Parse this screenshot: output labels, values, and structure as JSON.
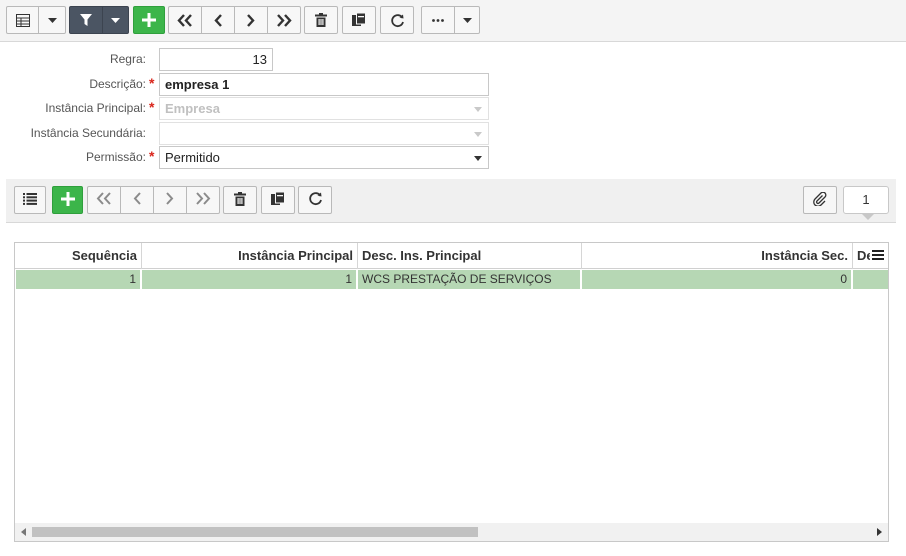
{
  "toolbar": {
    "icons": [
      "grid-view-icon",
      "chevron-down-icon",
      "filter-icon",
      "plus-icon",
      "first-record-icon",
      "previous-record-icon",
      "next-record-icon",
      "last-record-icon",
      "trash-icon",
      "copy-icon",
      "refresh-icon",
      "more-icon"
    ]
  },
  "form": {
    "regra": {
      "label": "Regra:",
      "value": "13"
    },
    "descricao": {
      "label": "Descrição:",
      "value": "empresa 1",
      "required": true
    },
    "instancia_principal": {
      "label": "Instância Principal:",
      "value": "Empresa",
      "required": true
    },
    "instancia_secundaria": {
      "label": "Instância Secundária:",
      "value": ""
    },
    "permissao": {
      "label": "Permissão:",
      "value": "Permitido",
      "required": true
    },
    "required_mark": "*"
  },
  "grid_toolbar": {
    "record_counter": "1"
  },
  "grid": {
    "columns": [
      "Sequência",
      "Instância Principal",
      "Desc. Ins. Principal",
      "Instância Sec.",
      "De"
    ],
    "rows": [
      {
        "sequencia": "1",
        "instancia_principal": "1",
        "desc_ins_principal": "WCS PRESTAÇÃO DE SERVIÇOS",
        "instancia_sec": "0",
        "extra": ""
      }
    ]
  },
  "colors": {
    "accent_green": "#3cb54a",
    "filter_button": "#4b5563",
    "selected_row": "#b6d7b4",
    "required": "#d9261c"
  }
}
